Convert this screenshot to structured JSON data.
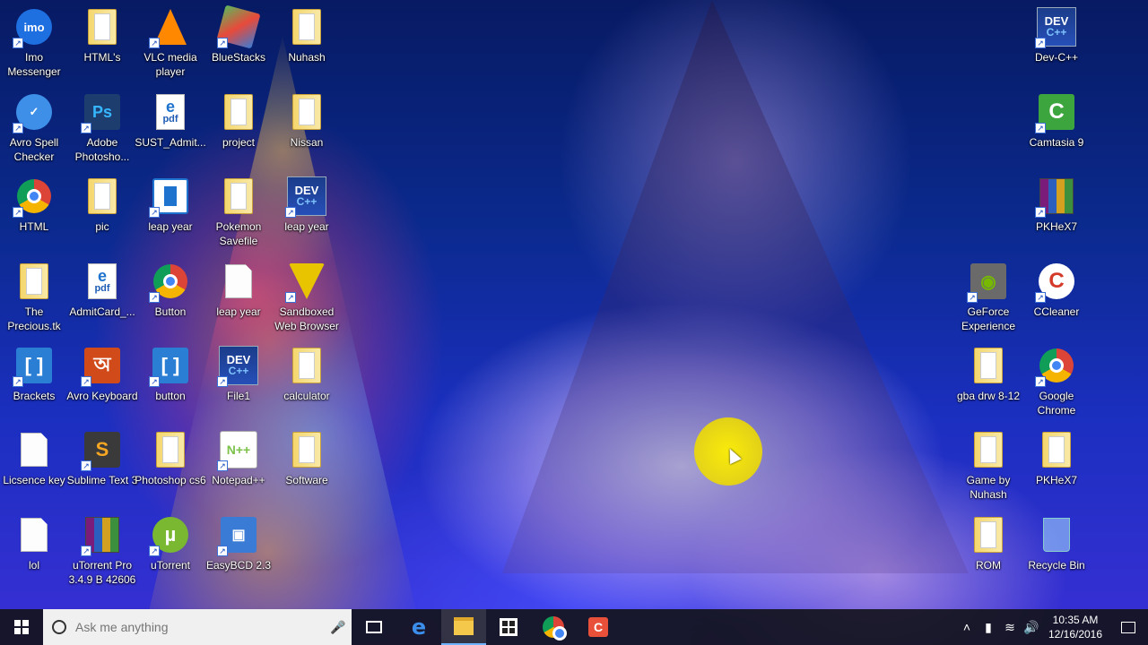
{
  "desktop": {
    "icons": [
      {
        "label": "Imo Messenger",
        "glyph": "imo",
        "color": "#1e6fe0"
      },
      {
        "label": "HTML's",
        "glyph": "folder"
      },
      {
        "label": "VLC media player",
        "glyph": "vlc",
        "color": "#ff8800"
      },
      {
        "label": "BlueStacks",
        "glyph": "bluestacks",
        "color": "#5cb85c"
      },
      {
        "label": "Nuhash",
        "glyph": "folder"
      },
      {
        "label": "Avro Spell Checker",
        "glyph": "check",
        "color": "#3d8fe8"
      },
      {
        "label": "Adobe Photosho...",
        "glyph": "ps",
        "color": "#1c3d6e"
      },
      {
        "label": "SUST_Admit...",
        "glyph": "pdf"
      },
      {
        "label": "project",
        "glyph": "folder"
      },
      {
        "label": "Nissan",
        "glyph": "folder"
      },
      {
        "label": "HTML",
        "glyph": "chrome"
      },
      {
        "label": "pic",
        "glyph": "folder"
      },
      {
        "label": "leap year",
        "glyph": "window",
        "color": "#1e73cf"
      },
      {
        "label": "Pokemon Savefile",
        "glyph": "folder"
      },
      {
        "label": "leap year",
        "glyph": "devcpp"
      },
      {
        "label": "The Precious.tk",
        "glyph": "folder"
      },
      {
        "label": "AdmitCard_...",
        "glyph": "pdf"
      },
      {
        "label": "Button",
        "glyph": "chrome"
      },
      {
        "label": "leap year",
        "glyph": "doc"
      },
      {
        "label": "Sandboxed Web Browser",
        "glyph": "sandboxie",
        "color": "#e8c400"
      },
      {
        "label": "Brackets",
        "glyph": "brackets",
        "color": "#2a7fd4"
      },
      {
        "label": "Avro Keyboard",
        "glyph": "avro",
        "color": "#d04a1a"
      },
      {
        "label": "button",
        "glyph": "brackets",
        "color": "#2a7fd4"
      },
      {
        "label": "File1",
        "glyph": "devcpp"
      },
      {
        "label": "calculator",
        "glyph": "folder"
      },
      {
        "label": "Licsence key",
        "glyph": "doc"
      },
      {
        "label": "Sublime Text 3",
        "glyph": "sublime",
        "color": "#3a3a3a"
      },
      {
        "label": "Photoshop cs6",
        "glyph": "folder"
      },
      {
        "label": "Notepad++",
        "glyph": "notepad",
        "color": "#7cc24a"
      },
      {
        "label": "Software",
        "glyph": "folder"
      },
      {
        "label": "lol",
        "glyph": "doc"
      },
      {
        "label": "uTorrent Pro 3.4.9 B 42606",
        "glyph": "rar"
      },
      {
        "label": "uTorrent",
        "glyph": "utorrent",
        "color": "#79b830"
      },
      {
        "label": "EasyBCD 2.3",
        "glyph": "easybcd",
        "color": "#3a7bd5"
      },
      {
        "label": "Dev-C++",
        "glyph": "devcpp"
      },
      {
        "label": "Camtasia 9",
        "glyph": "camtasia",
        "color": "#3da53d"
      },
      {
        "label": "PKHeX7",
        "glyph": "rar"
      },
      {
        "label": "GeForce Experience",
        "glyph": "geforce",
        "color": "#6a6a6a"
      },
      {
        "label": "CCleaner",
        "glyph": "ccleaner",
        "color": "#d43a2a"
      },
      {
        "label": "gba drw 8-12",
        "glyph": "folder"
      },
      {
        "label": "Google Chrome",
        "glyph": "chrome"
      },
      {
        "label": "Game by Nuhash",
        "glyph": "folder"
      },
      {
        "label": "PKHeX7",
        "glyph": "folder"
      },
      {
        "label": "ROM",
        "glyph": "folder"
      },
      {
        "label": "Recycle Bin",
        "glyph": "recycle",
        "color": "#6ab0e8"
      }
    ]
  },
  "taskbar": {
    "search_placeholder": "Ask me anything",
    "apps": [
      {
        "name": "task-view"
      },
      {
        "name": "edge"
      },
      {
        "name": "file-explorer"
      },
      {
        "name": "store"
      },
      {
        "name": "chrome"
      },
      {
        "name": "camtasia"
      }
    ],
    "clock": {
      "time": "10:35 AM",
      "date": "12/16/2016"
    }
  },
  "theme": {
    "accent": "#6fb2ff",
    "taskbar_bg": "#14141c"
  }
}
